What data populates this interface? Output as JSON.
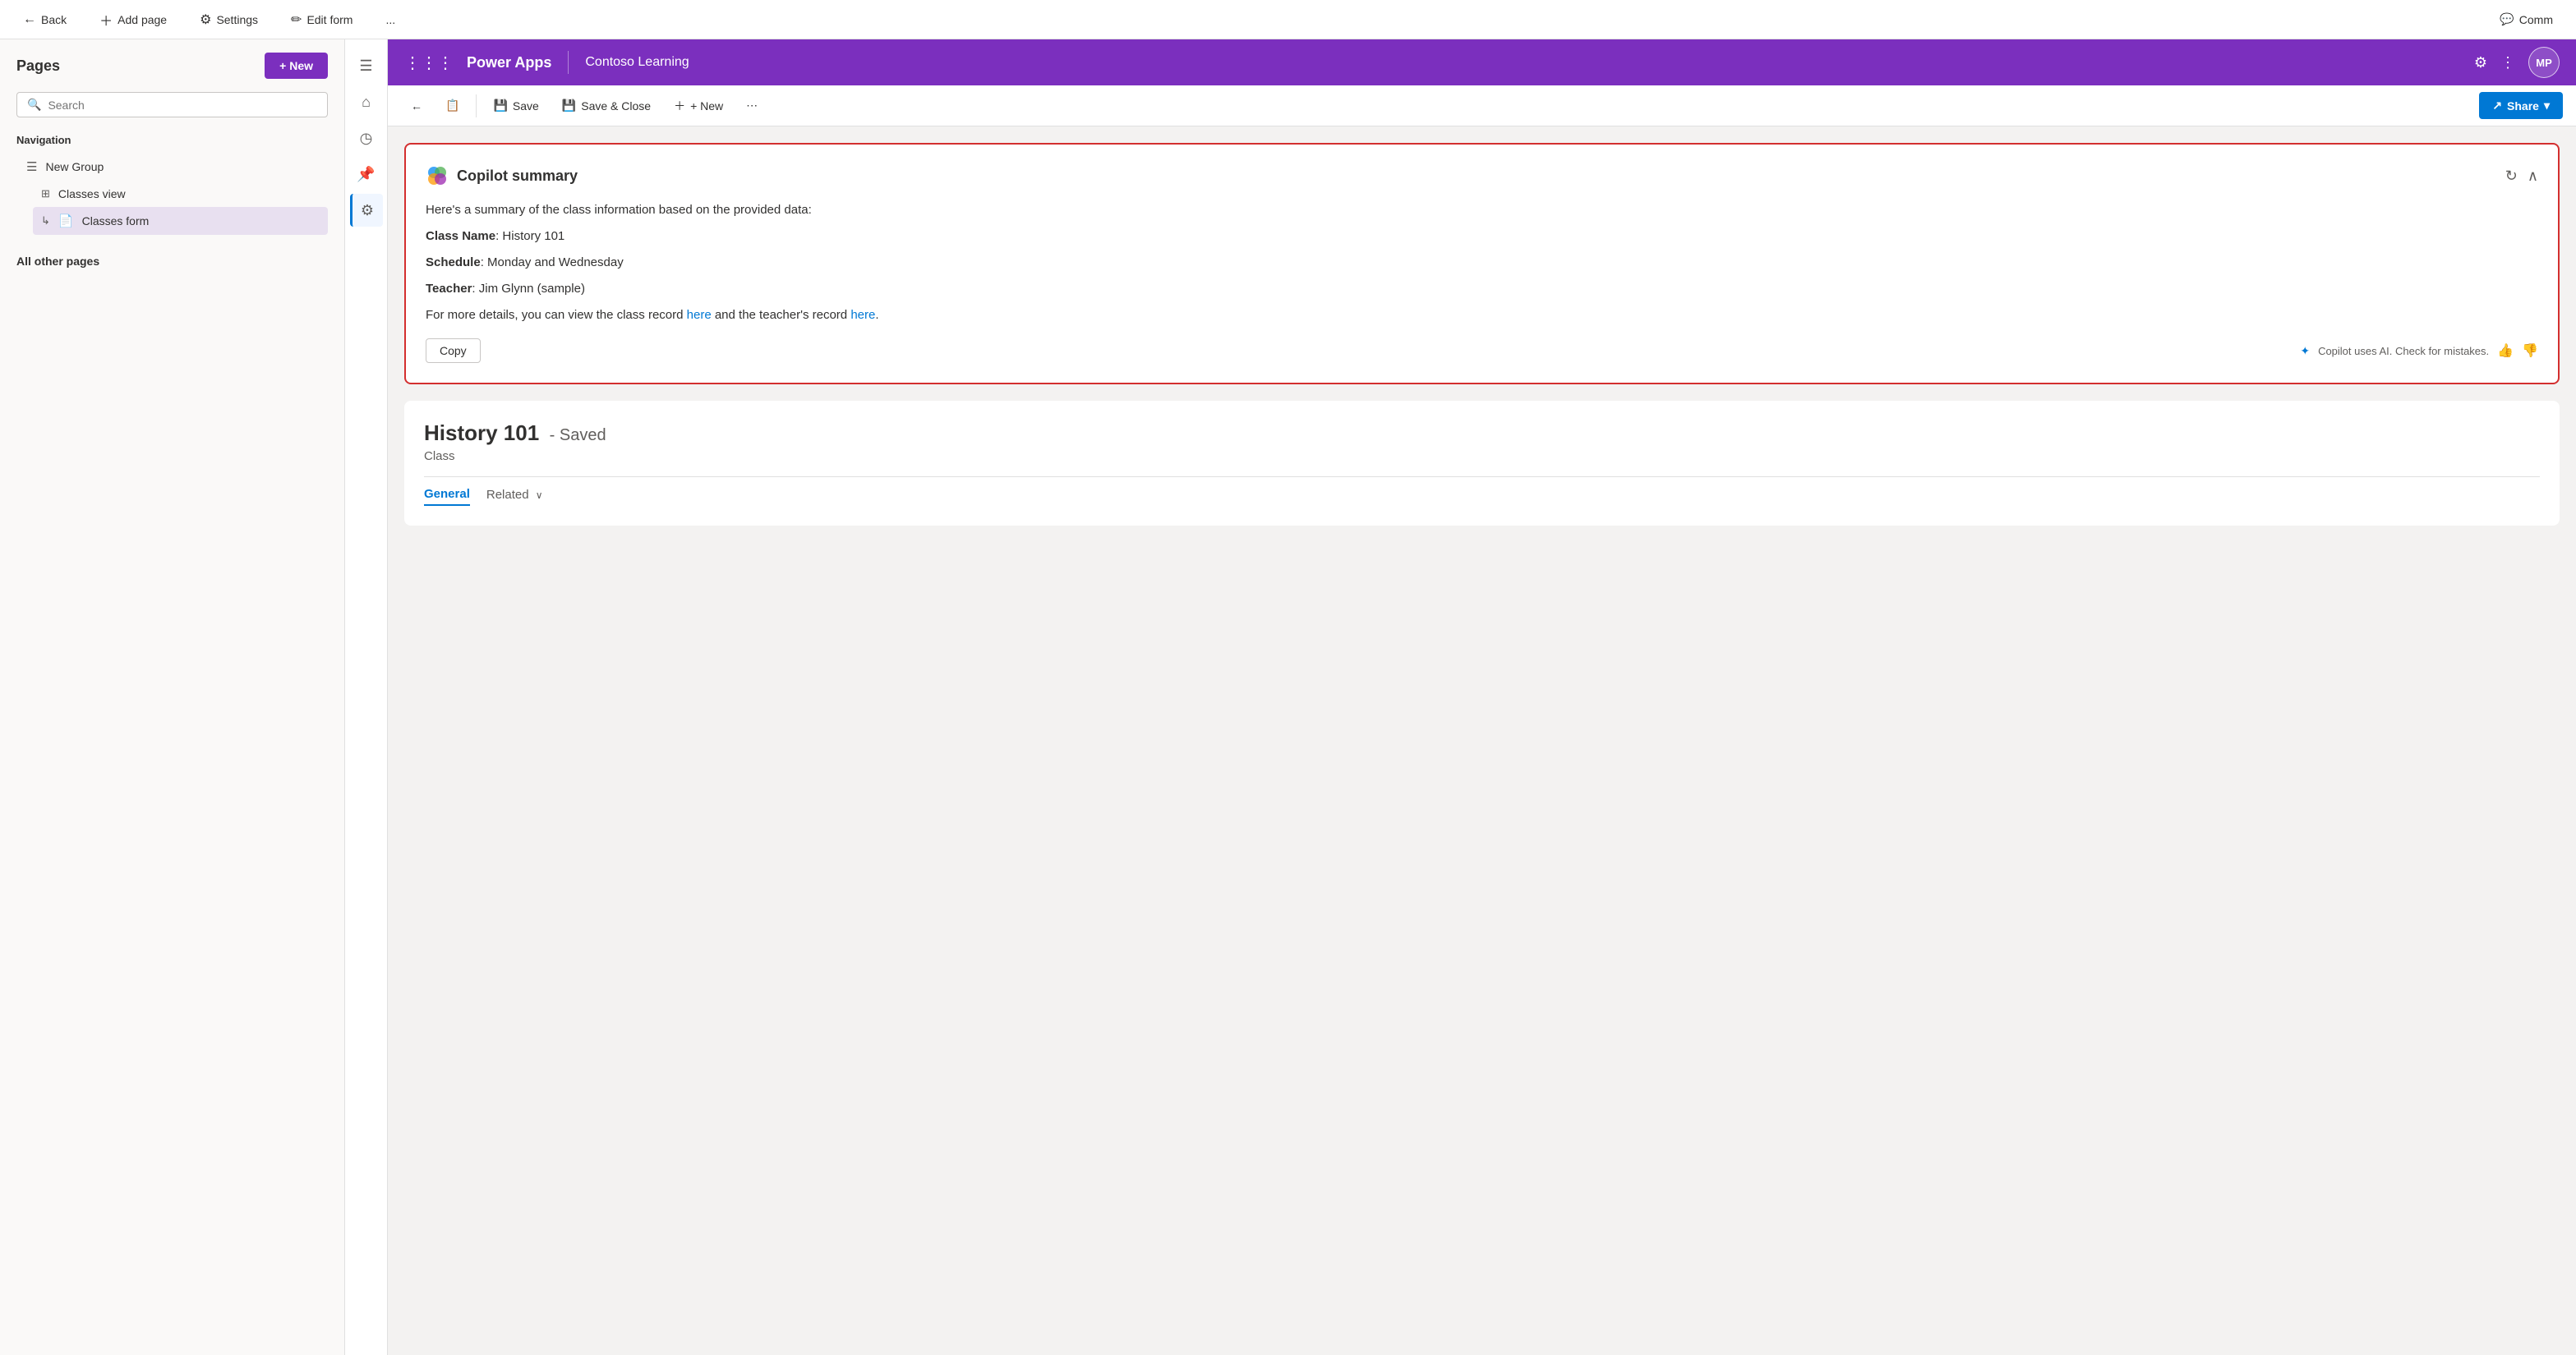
{
  "topbar": {
    "back_label": "Back",
    "add_page_label": "Add page",
    "settings_label": "Settings",
    "edit_form_label": "Edit form",
    "more_label": "...",
    "comm_label": "Comm"
  },
  "pages_panel": {
    "title": "Pages",
    "new_label": "+ New",
    "search_placeholder": "Search",
    "nav_title": "Navigation",
    "nav_items": [
      {
        "icon": "☰",
        "label": "New Group",
        "sub": false
      },
      {
        "icon": "⊞",
        "label": "Classes view",
        "sub": true
      },
      {
        "icon": "⊡",
        "label": "Classes form",
        "sub": true,
        "active": true
      }
    ],
    "other_pages_title": "All other pages"
  },
  "app_header": {
    "app_name": "Power Apps",
    "sub_name": "Contoso Learning",
    "avatar": "MP"
  },
  "toolbar": {
    "back_label": "←",
    "save_label": "Save",
    "save_close_label": "Save & Close",
    "new_label": "+ New",
    "more_label": "⋯",
    "share_label": "Share"
  },
  "copilot": {
    "title": "Copilot summary",
    "intro": "Here's a summary of the class information based on the provided data:",
    "fields": [
      {
        "label": "Class Name",
        "value": ": History 101"
      },
      {
        "label": "Schedule",
        "value": ": Monday and Wednesday"
      },
      {
        "label": "Teacher",
        "value": ":  Jim Glynn (sample)"
      }
    ],
    "details_text": "For more details, you can view the class record ",
    "link1": "here",
    "link_middle": " and the teacher's record ",
    "link2": "here",
    "link_end": ".",
    "copy_label": "Copy",
    "ai_notice": "Copilot uses AI. Check for mistakes.",
    "thumbup_label": "👍",
    "thumbdown_label": "👎"
  },
  "record": {
    "title": "History 101",
    "saved_label": "- Saved",
    "type": "Class",
    "tabs": [
      {
        "label": "General",
        "active": true
      },
      {
        "label": "Related",
        "has_chevron": true
      }
    ]
  },
  "icon_sidebar": [
    {
      "icon": "☰",
      "name": "hamburger",
      "active": false
    },
    {
      "icon": "⌂",
      "name": "home",
      "active": false
    },
    {
      "icon": "◷",
      "name": "recent",
      "active": false
    },
    {
      "icon": "📌",
      "name": "pinned",
      "active": false
    },
    {
      "icon": "⚙",
      "name": "settings",
      "active": true
    }
  ]
}
